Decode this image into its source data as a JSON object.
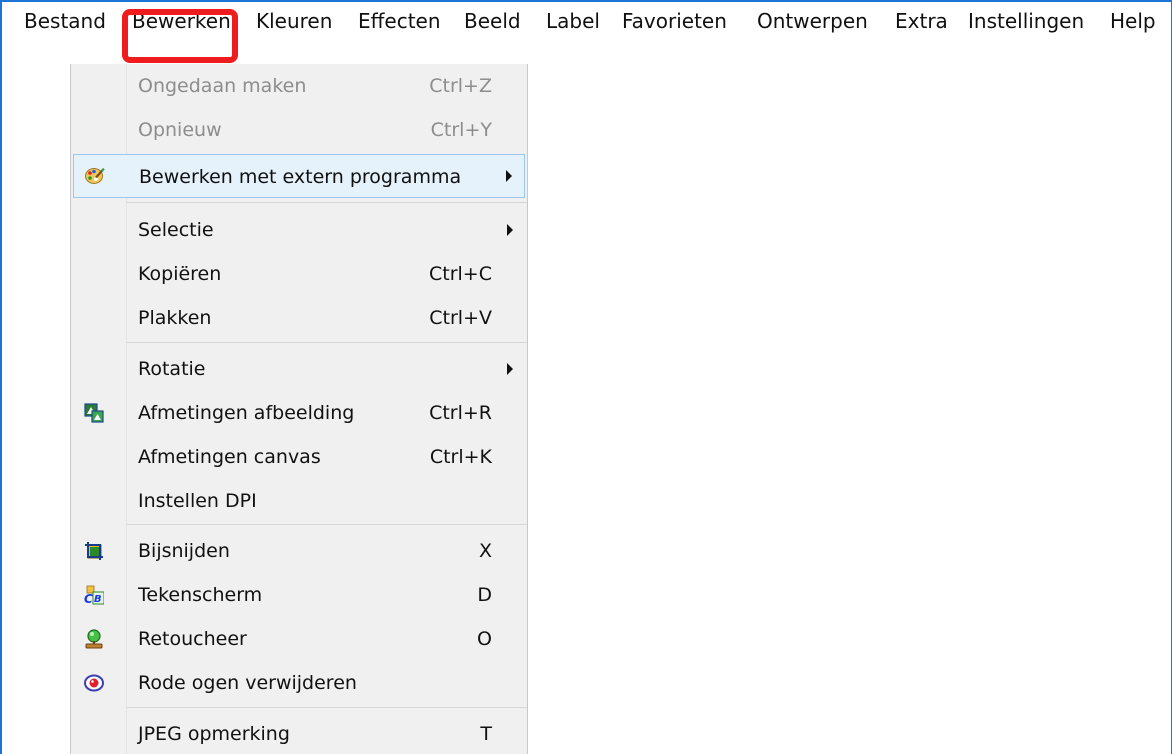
{
  "menubar": {
    "items": [
      "Bestand",
      "Bewerken",
      "Kleuren",
      "Effecten",
      "Beeld",
      "Label",
      "Favorieten",
      "Ontwerpen",
      "Extra",
      "Instellingen",
      "Help"
    ],
    "active": "Bewerken"
  },
  "menu": {
    "title": "Bewerken",
    "items": [
      {
        "label": "Ongedaan maken",
        "shortcut": "Ctrl+Z",
        "enabled": false
      },
      {
        "label": "Opnieuw",
        "shortcut": "Ctrl+Y",
        "enabled": false
      },
      {
        "label": "Bewerken met extern programma",
        "submenu": true,
        "icon": "palette-icon",
        "highlighted": true
      },
      {
        "label": "Selectie",
        "submenu": true
      },
      {
        "label": "Kopiëren",
        "shortcut": "Ctrl+C"
      },
      {
        "label": "Plakken",
        "shortcut": "Ctrl+V"
      },
      {
        "label": "Rotatie",
        "submenu": true
      },
      {
        "label": "Afmetingen afbeelding",
        "shortcut": "Ctrl+R",
        "icon": "resize-image-icon"
      },
      {
        "label": "Afmetingen canvas",
        "shortcut": "Ctrl+K"
      },
      {
        "label": "Instellen DPI"
      },
      {
        "label": "Bijsnijden",
        "shortcut": "X",
        "icon": "crop-icon"
      },
      {
        "label": "Tekenscherm",
        "shortcut": "D",
        "icon": "draw-panel-icon"
      },
      {
        "label": "Retoucheer",
        "shortcut": "O",
        "icon": "retouch-icon"
      },
      {
        "label": "Rode ogen verwijderen",
        "icon": "red-eye-icon"
      },
      {
        "label": "JPEG opmerking",
        "shortcut": "T"
      }
    ]
  },
  "colors": {
    "highlight_box": "#ee1c1c",
    "menu_background": "#f0f0f0",
    "hover_background": "#e5f1fb",
    "hover_border": "#99c7ef",
    "disabled_text": "#8d8d8d",
    "window_border": "#1e73d6"
  }
}
